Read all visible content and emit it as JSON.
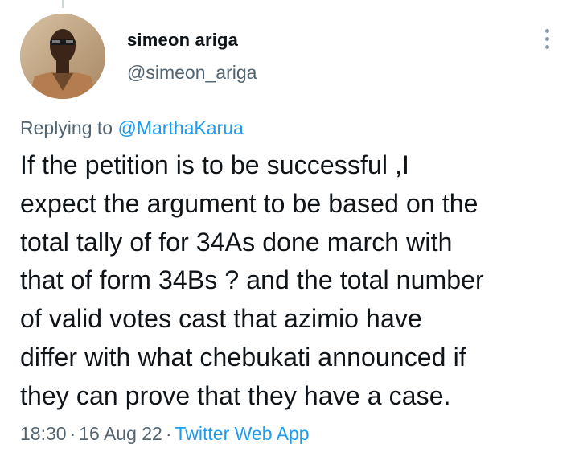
{
  "author": {
    "name": "simeon ariga",
    "handle": "@simeon_ariga"
  },
  "reply": {
    "prefix": "Replying to ",
    "mention": "@MarthaKarua"
  },
  "tweet": {
    "text": "If the petition is to be successful ,I\nexpect the argument to be based on the\ntotal tally of for 34As  done march with\nthat of form 34Bs ? and the total number\nof valid votes cast that azimio have\ndiffer with what chebukati announced if\nthey can prove that they have a case."
  },
  "meta": {
    "time": "18:30",
    "date": "16 Aug 22",
    "separator": "·",
    "source": "Twitter Web App"
  },
  "icons": {
    "more": "more-vertical-icon",
    "avatar": "profile-photo"
  },
  "colors": {
    "text": "#0f1419",
    "secondary": "#536471",
    "link": "#1d9bf0",
    "thread_line": "#cfd9de"
  }
}
